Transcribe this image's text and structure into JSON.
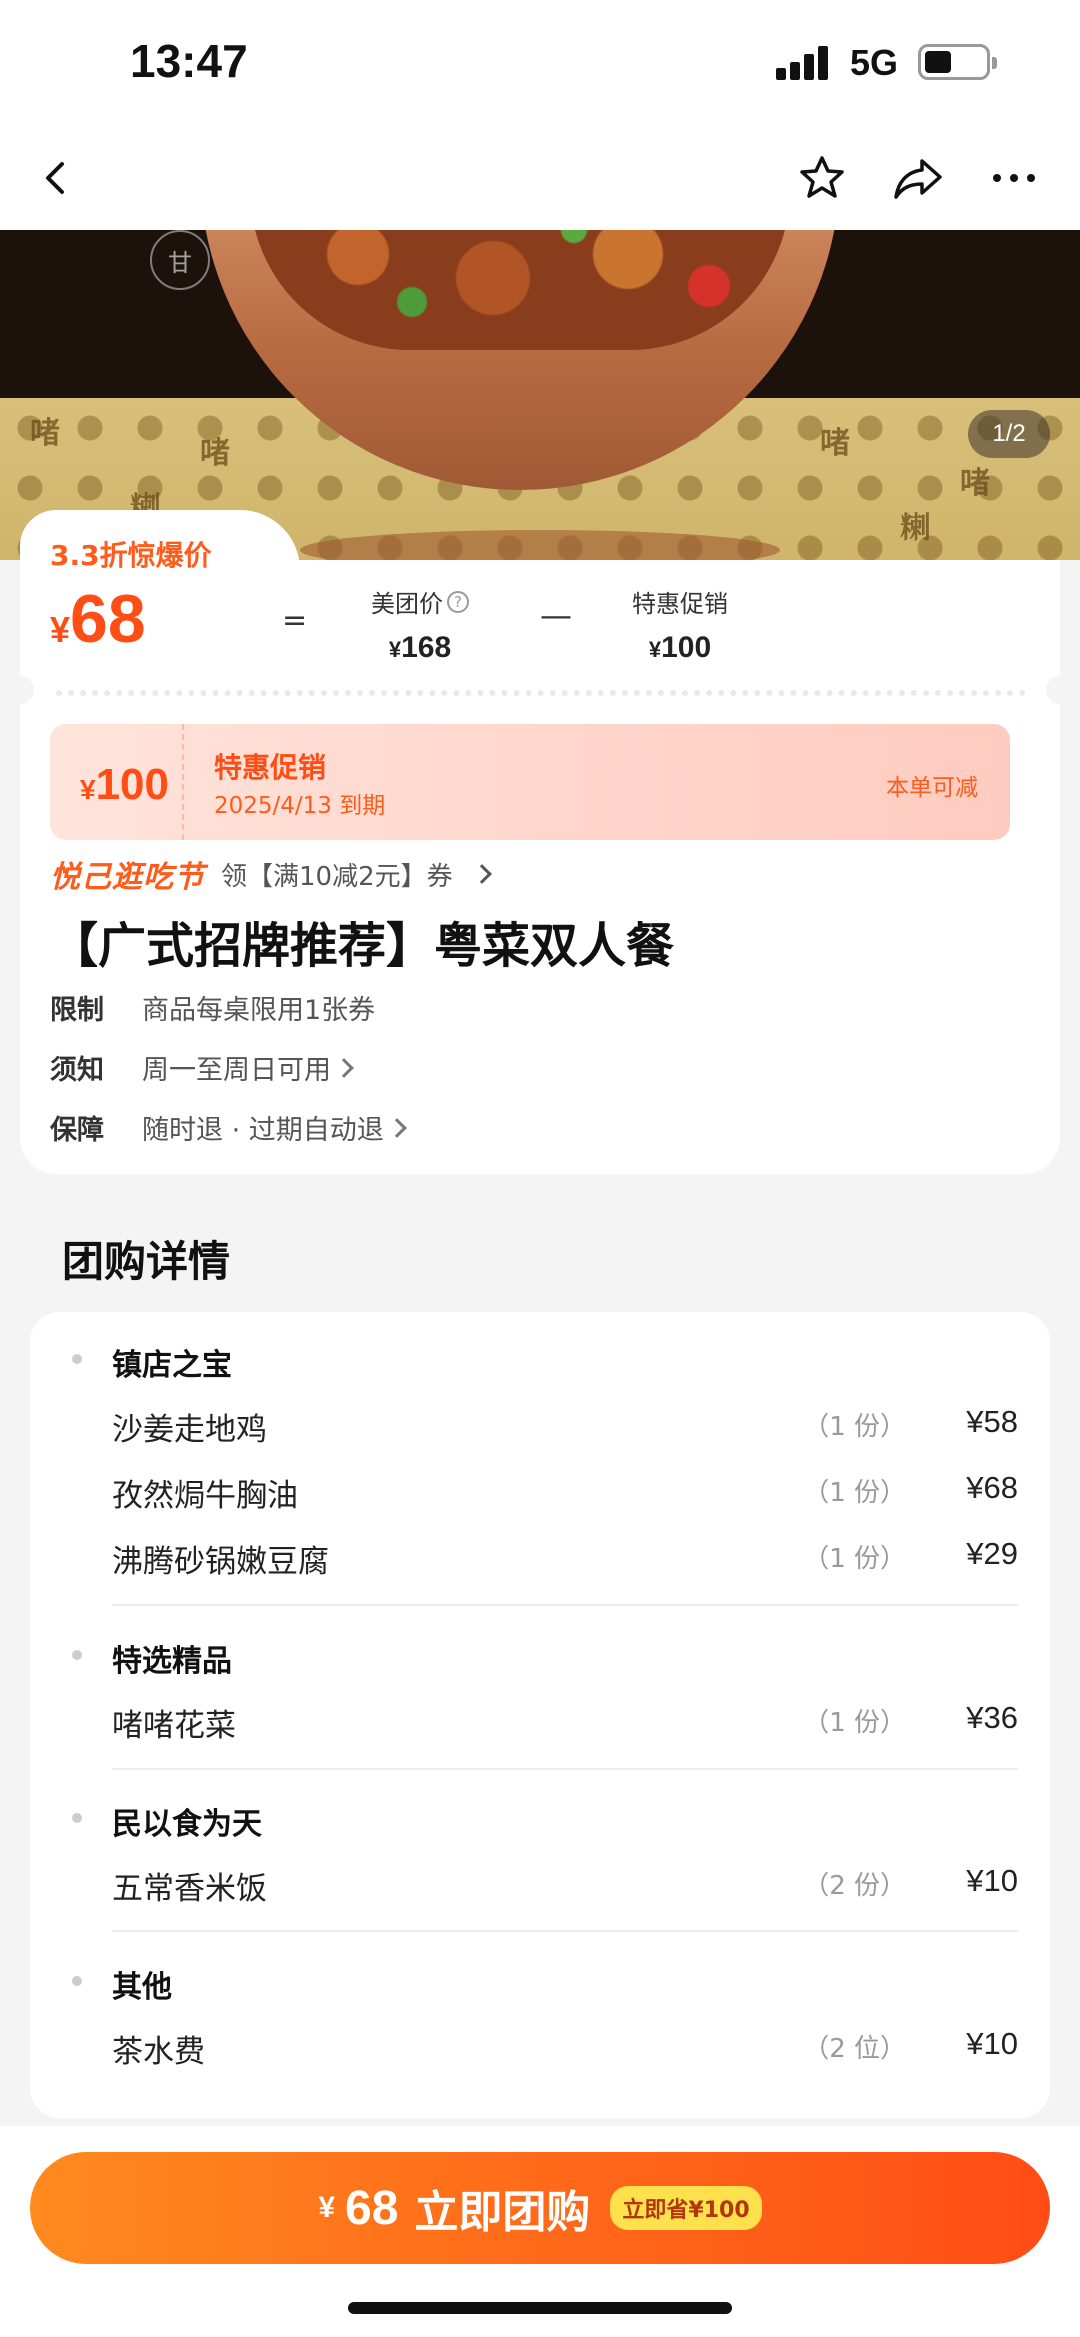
{
  "status": {
    "time": "13:47",
    "network": "5G"
  },
  "hero": {
    "pager": "1/2"
  },
  "deal": {
    "tag": "3.3折惊爆价",
    "price_currency": "¥",
    "price": "68",
    "equals": "=",
    "minus": "—",
    "meituan_label": "美团价",
    "meituan_currency": "¥",
    "meituan_price": "168",
    "promo_label": "特惠促销",
    "promo_currency": "¥",
    "promo_price": "100"
  },
  "coupon": {
    "currency": "¥",
    "amount": "100",
    "title": "特惠促销",
    "date": "2025/4/13 到期",
    "right_label": "本单可减"
  },
  "promo_bar": {
    "logo": "悦己逛吃节",
    "text": "领【满10减2元】券"
  },
  "title": "【广式招牌推荐】粤菜双人餐",
  "info": [
    {
      "key": "限制",
      "value": "商品每桌限用1张券"
    },
    {
      "key": "须知",
      "value": "周一至周日可用"
    },
    {
      "key": "保障",
      "value": "随时退 · 过期自动退"
    }
  ],
  "details": {
    "section_title": "团购详情",
    "groups": [
      {
        "name": "镇店之宝",
        "items": [
          {
            "name": "沙姜走地鸡",
            "qty": "（1 份）",
            "price": "¥58"
          },
          {
            "name": "孜然焗牛胸油",
            "qty": "（1 份）",
            "price": "¥68"
          },
          {
            "name": "沸腾砂锅嫩豆腐",
            "qty": "（1 份）",
            "price": "¥29"
          }
        ]
      },
      {
        "name": "特选精品",
        "items": [
          {
            "name": "啫啫花菜",
            "qty": "（1 份）",
            "price": "¥36"
          }
        ]
      },
      {
        "name": "民以食为天",
        "items": [
          {
            "name": "五常香米饭",
            "qty": "（2 份）",
            "price": "¥10"
          }
        ]
      },
      {
        "name": "其他",
        "items": [
          {
            "name": "茶水费",
            "qty": "（2 位）",
            "price": "¥10"
          }
        ]
      }
    ]
  },
  "buy_button": {
    "currency": "¥",
    "amount": "68",
    "label": "立即团购",
    "save": "立即省¥100"
  },
  "colors": {
    "accent": "#ff4d15",
    "accent_light": "#ff8a1e",
    "save_pill": "#ffe14d"
  }
}
